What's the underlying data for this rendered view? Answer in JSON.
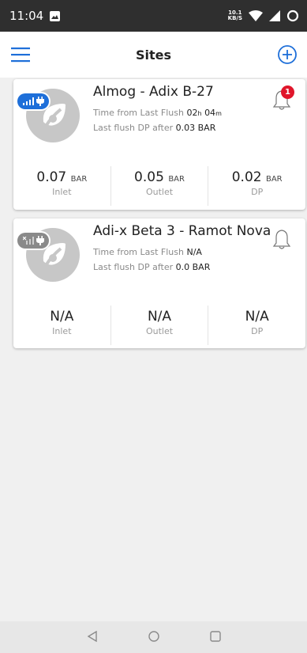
{
  "status_bar": {
    "time": "11:04",
    "net_speed_value": "10.1",
    "net_speed_unit": "KB/S"
  },
  "app_bar": {
    "title": "Sites"
  },
  "sites": [
    {
      "name": "Almog - Adix B-27",
      "time_label": "Time from Last Flush",
      "time_hours": "02",
      "time_hours_unit": "h",
      "time_minutes": "04",
      "time_minutes_unit": "m",
      "flush_label": "Last flush DP after",
      "flush_value": "0.03 BAR",
      "connection": "online",
      "notification_count": "1",
      "metrics": [
        {
          "value": "0.07",
          "unit": "BAR",
          "label": "Inlet"
        },
        {
          "value": "0.05",
          "unit": "BAR",
          "label": "Outlet"
        },
        {
          "value": "0.02",
          "unit": "BAR",
          "label": "DP"
        }
      ]
    },
    {
      "name": "Adi-x Beta 3 - Ramot Nova",
      "time_label": "Time from Last Flush",
      "time_value": "N/A",
      "flush_label": "Last flush DP after",
      "flush_value": "0.0 BAR",
      "connection": "offline",
      "metrics": [
        {
          "value": "N/A",
          "label": "Inlet"
        },
        {
          "value": "N/A",
          "label": "Outlet"
        },
        {
          "value": "N/A",
          "label": "DP"
        }
      ]
    }
  ],
  "colors": {
    "accent": "#1e6fd9",
    "alert": "#e0162b",
    "status_bar": "#2f2f2f"
  }
}
